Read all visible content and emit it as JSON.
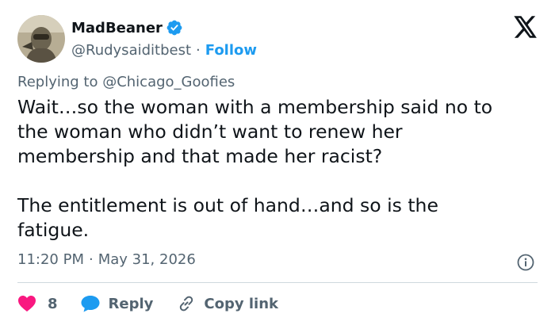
{
  "author": {
    "display_name": "MadBeaner",
    "handle": "@Rudysaiditbest",
    "separator": "·",
    "follow_label": "Follow"
  },
  "reply_context": {
    "prefix": "Replying to ",
    "mention": "@Chicago_Goofies"
  },
  "tweet": {
    "text": "Wait…so the woman with a membership said no to\nthe woman who didn’t want to renew her\nmembership and that made her racist?\n\nThe entitlement is out of hand…and so is the\nfatigue.",
    "time": "11:20 PM",
    "separator": "·",
    "date": "May 31, 2026"
  },
  "actions": {
    "like_count": "8",
    "reply_label": "Reply",
    "copy_label": "Copy link"
  },
  "icons": {
    "verified": "verified-badge-icon",
    "brand": "x-logo-icon",
    "info": "info-icon",
    "like": "heart-icon",
    "reply": "speech-bubble-icon",
    "copy": "link-icon"
  },
  "colors": {
    "text": "#0f1419",
    "secondary": "#536471",
    "accent": "#1d9bf0",
    "like": "#f91880",
    "divider": "#cfd9de"
  }
}
